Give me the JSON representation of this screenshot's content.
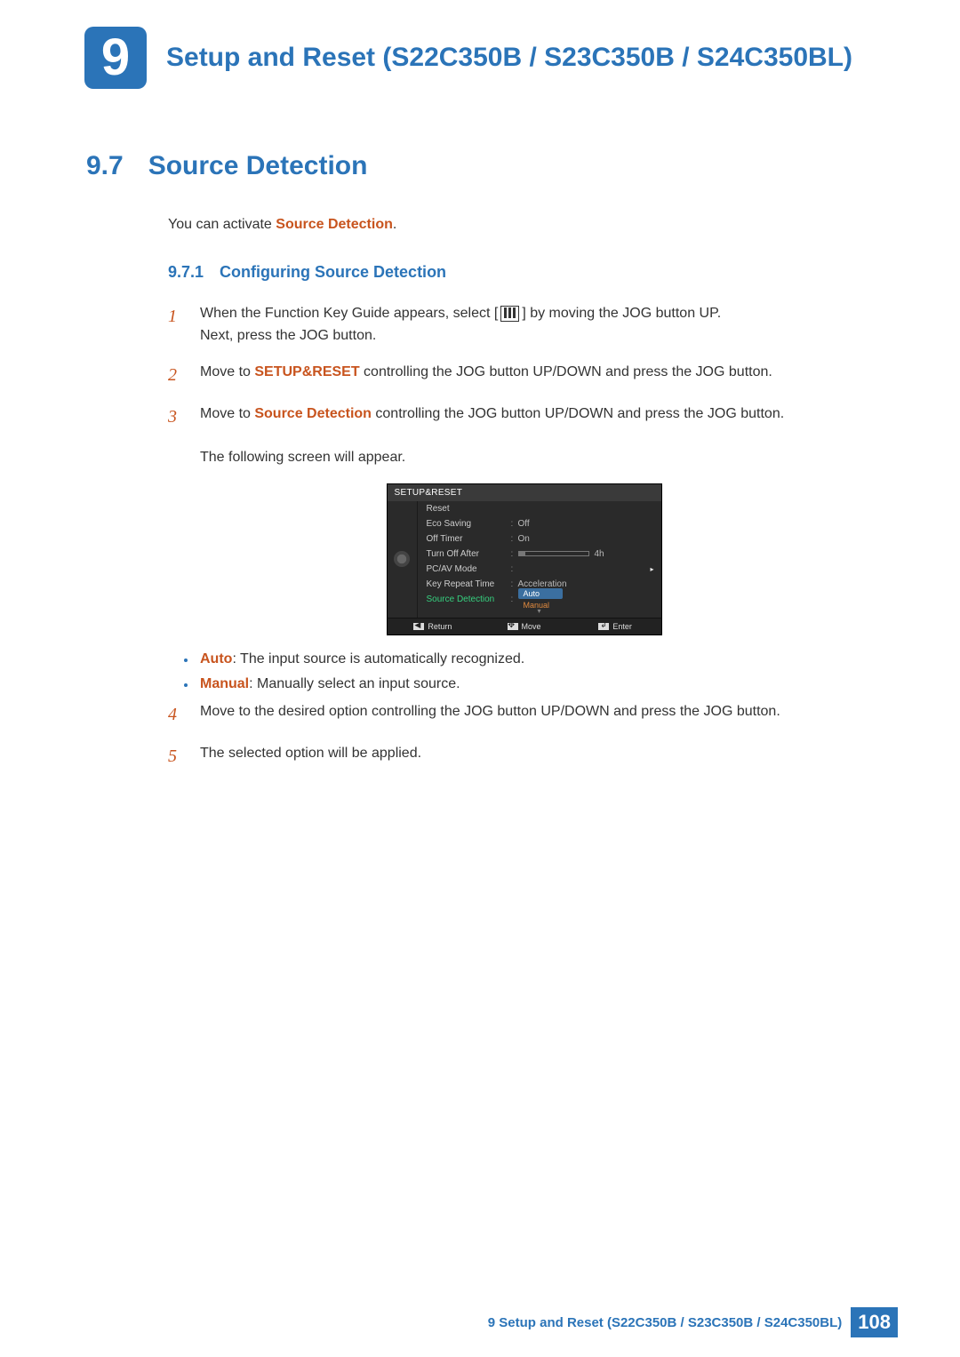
{
  "chapter": {
    "number": "9",
    "title": "Setup and Reset (S22C350B / S23C350B / S24C350BL)"
  },
  "section": {
    "number": "9.7",
    "title": "Source Detection"
  },
  "intro": {
    "prefix": "You can activate ",
    "accent": "Source Detection",
    "suffix": "."
  },
  "subsection": {
    "number": "9.7.1",
    "title": "Configuring Source Detection"
  },
  "steps": {
    "s1": {
      "num": "1",
      "a": "When the Function Key Guide appears, select ",
      "b": " by moving the JOG button UP.",
      "c": "Next, press the JOG button."
    },
    "s2": {
      "num": "2",
      "a": "Move to ",
      "accent": "SETUP&RESET",
      "b": " controlling the JOG button UP/DOWN and press the JOG button."
    },
    "s3": {
      "num": "3",
      "a": "Move to ",
      "accent": "Source Detection",
      "b": " controlling the JOG button UP/DOWN and press the JOG button.",
      "c": "The following screen will appear."
    },
    "s4": {
      "num": "4",
      "text": "Move to the desired option controlling the JOG button UP/DOWN and press the JOG button."
    },
    "s5": {
      "num": "5",
      "text": "The selected option will be applied."
    }
  },
  "bullets": {
    "b1": {
      "accent": "Auto",
      "text": ": The input source is automatically recognized."
    },
    "b2": {
      "accent": "Manual",
      "text": ": Manually select an input source."
    }
  },
  "osd": {
    "title": "SETUP&RESET",
    "rows": {
      "reset": "Reset",
      "eco": "Eco Saving",
      "eco_val": "Off",
      "timer": "Off Timer",
      "timer_val": "On",
      "turnoff": "Turn Off After",
      "turnoff_val": "4h",
      "pcav": "PC/AV Mode",
      "krt": "Key Repeat Time",
      "krt_val": "Acceleration",
      "src": "Source Detection",
      "src_sel": "Auto",
      "src_sub": "Manual"
    },
    "foot": {
      "return": "Return",
      "move": "Move",
      "enter": "Enter"
    }
  },
  "footer": {
    "text": "9 Setup and Reset (S22C350B / S23C350B / S24C350BL)",
    "page": "108"
  }
}
